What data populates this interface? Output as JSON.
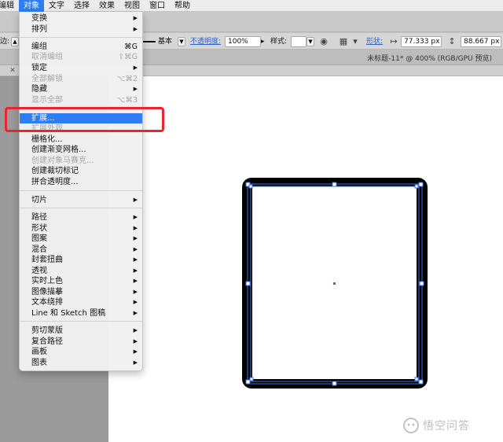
{
  "menubar": {
    "items": [
      "编辑",
      "对象",
      "文字",
      "选择",
      "效果",
      "视图",
      "窗口",
      "帮助"
    ],
    "active_index": 1
  },
  "controlbar": {
    "stroke_label": "边:",
    "stroke_style": "基本",
    "opacity_label": "不透明度:",
    "opacity_value": "100%",
    "style_label": "样式:",
    "shape_label": "形状:",
    "width_value": "77.333 px",
    "height_value": "88.667 px"
  },
  "document": {
    "title": "未标题-11* @ 400% (RGB/GPU 预览)"
  },
  "object_menu": {
    "items": [
      {
        "label": "变换",
        "shortcut": "",
        "submenu": true,
        "disabled": false
      },
      {
        "label": "排列",
        "shortcut": "",
        "submenu": true,
        "disabled": false
      },
      {
        "label": "编组",
        "shortcut": "⌘G",
        "submenu": false,
        "disabled": false
      },
      {
        "label": "取消编组",
        "shortcut": "⇧⌘G",
        "submenu": false,
        "disabled": true
      },
      {
        "label": "锁定",
        "shortcut": "",
        "submenu": true,
        "disabled": false
      },
      {
        "label": "全部解锁",
        "shortcut": "⌥⌘2",
        "submenu": false,
        "disabled": true
      },
      {
        "label": "隐藏",
        "shortcut": "",
        "submenu": true,
        "disabled": false
      },
      {
        "label": "显示全部",
        "shortcut": "⌥⌘3",
        "submenu": false,
        "disabled": true
      },
      {
        "label": "扩展...",
        "shortcut": "",
        "submenu": false,
        "disabled": false,
        "highlight": true
      },
      {
        "label": "扩展外观",
        "shortcut": "",
        "submenu": false,
        "disabled": true
      },
      {
        "label": "栅格化...",
        "shortcut": "",
        "submenu": false,
        "disabled": false
      },
      {
        "label": "创建渐变网格...",
        "shortcut": "",
        "submenu": false,
        "disabled": false
      },
      {
        "label": "创建对象马赛克...",
        "shortcut": "",
        "submenu": false,
        "disabled": true
      },
      {
        "label": "创建裁切标记",
        "shortcut": "",
        "submenu": false,
        "disabled": false
      },
      {
        "label": "拼合透明度...",
        "shortcut": "",
        "submenu": false,
        "disabled": false
      },
      {
        "label": "切片",
        "shortcut": "",
        "submenu": true,
        "disabled": false
      },
      {
        "label": "路径",
        "shortcut": "",
        "submenu": true,
        "disabled": false
      },
      {
        "label": "形状",
        "shortcut": "",
        "submenu": true,
        "disabled": false
      },
      {
        "label": "图案",
        "shortcut": "",
        "submenu": true,
        "disabled": false
      },
      {
        "label": "混合",
        "shortcut": "",
        "submenu": true,
        "disabled": false
      },
      {
        "label": "封套扭曲",
        "shortcut": "",
        "submenu": true,
        "disabled": false
      },
      {
        "label": "透视",
        "shortcut": "",
        "submenu": true,
        "disabled": false
      },
      {
        "label": "实时上色",
        "shortcut": "",
        "submenu": true,
        "disabled": false
      },
      {
        "label": "图像描摹",
        "shortcut": "",
        "submenu": true,
        "disabled": false
      },
      {
        "label": "文本绕排",
        "shortcut": "",
        "submenu": true,
        "disabled": false
      },
      {
        "label": "Line 和 Sketch 图稿",
        "shortcut": "",
        "submenu": true,
        "disabled": false
      },
      {
        "label": "剪切蒙版",
        "shortcut": "",
        "submenu": true,
        "disabled": false
      },
      {
        "label": "复合路径",
        "shortcut": "",
        "submenu": true,
        "disabled": false
      },
      {
        "label": "画板",
        "shortcut": "",
        "submenu": true,
        "disabled": false
      },
      {
        "label": "图表",
        "shortcut": "",
        "submenu": true,
        "disabled": false
      }
    ]
  },
  "watermark": {
    "text": "悟空问答"
  },
  "colors": {
    "menu_highlight": "#2f7ef1",
    "annotation": "#e8262f",
    "selection": "#3b6fe0"
  }
}
